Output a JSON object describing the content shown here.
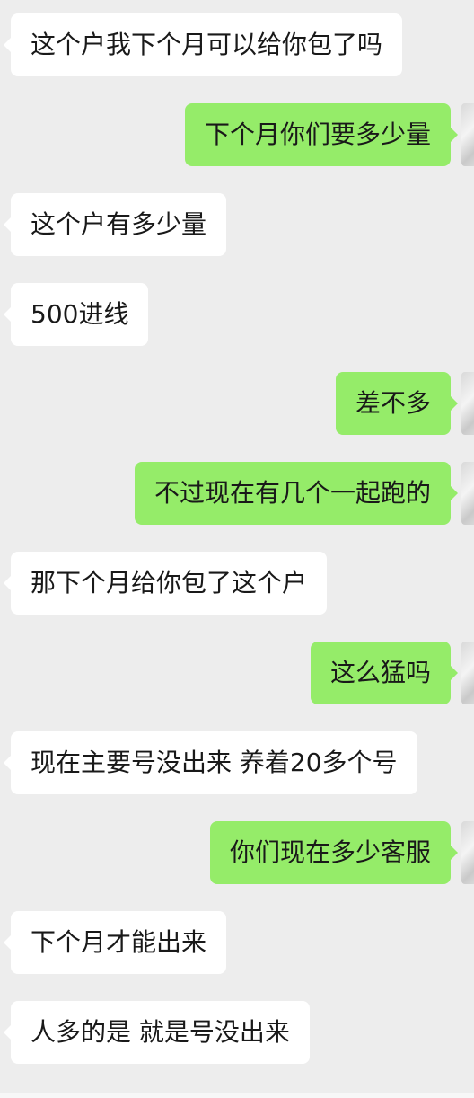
{
  "colors": {
    "background": "#ededed",
    "incoming_bubble": "#ffffff",
    "outgoing_bubble": "#95ec69",
    "text": "#191919"
  },
  "messages": [
    {
      "side": "left",
      "text": "这个户我下个月可以给你包了吗"
    },
    {
      "side": "right",
      "text": "下个月你们要多少量"
    },
    {
      "side": "left",
      "text": "这个户有多少量"
    },
    {
      "side": "left",
      "text": "500进线"
    },
    {
      "side": "right",
      "text": "差不多"
    },
    {
      "side": "right",
      "text": "不过现在有几个一起跑的"
    },
    {
      "side": "left",
      "text": "那下个月给你包了这个户"
    },
    {
      "side": "right",
      "text": "这么猛吗"
    },
    {
      "side": "left",
      "text": "现在主要号没出来 养着20多个号"
    },
    {
      "side": "right",
      "text": "你们现在多少客服"
    },
    {
      "side": "left",
      "text": "下个月才能出来"
    },
    {
      "side": "left",
      "text": "人多的是 就是号没出来"
    }
  ]
}
